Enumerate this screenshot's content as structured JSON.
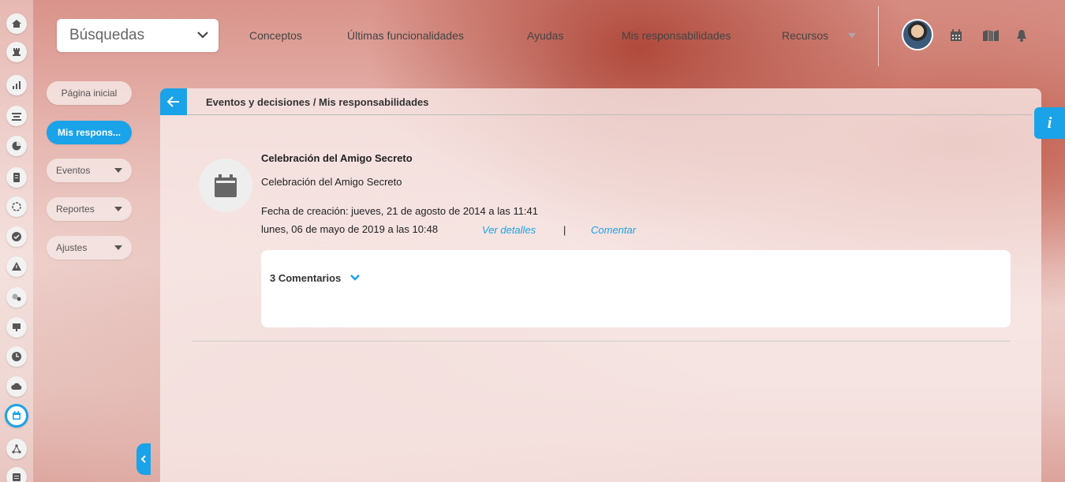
{
  "topbar": {
    "search_label": "Búsquedas",
    "nav": [
      "Conceptos",
      "Últimas funcionalidades",
      "Ayudas",
      "Mis responsabilidades",
      "Recursos"
    ]
  },
  "sidemenu": {
    "items": [
      "Página inicial",
      "Mis respons...",
      "Eventos",
      "Reportes",
      "Ajustes"
    ]
  },
  "panel": {
    "breadcrumb": "Eventos y decisiones / Mis responsabilidades",
    "event_title": "Celebración del Amigo Secreto",
    "event_description": "Celebración del Amigo Secreto",
    "created": "Fecha de creación: jueves, 21 de agosto de 2014 a las 11:41",
    "date": "lunes, 06 de mayo de 2019 a las 10:48",
    "view_details": "Ver detalles",
    "separator": "|",
    "comment": "Comentar",
    "comments_label": "3 Comentarios"
  },
  "info_tab": "i",
  "colors": {
    "accent": "#1aa3e8"
  },
  "icons": [
    "home-icon",
    "rook-icon",
    "bar-chart-icon",
    "strategy-icon",
    "pie-chart-icon",
    "document-icon",
    "circle-icon",
    "check-icon",
    "warning-icon",
    "toggle-icon",
    "presentation-icon",
    "clock-icon",
    "cloud-icon",
    "calendar-icon",
    "network-icon",
    "list-icon"
  ]
}
